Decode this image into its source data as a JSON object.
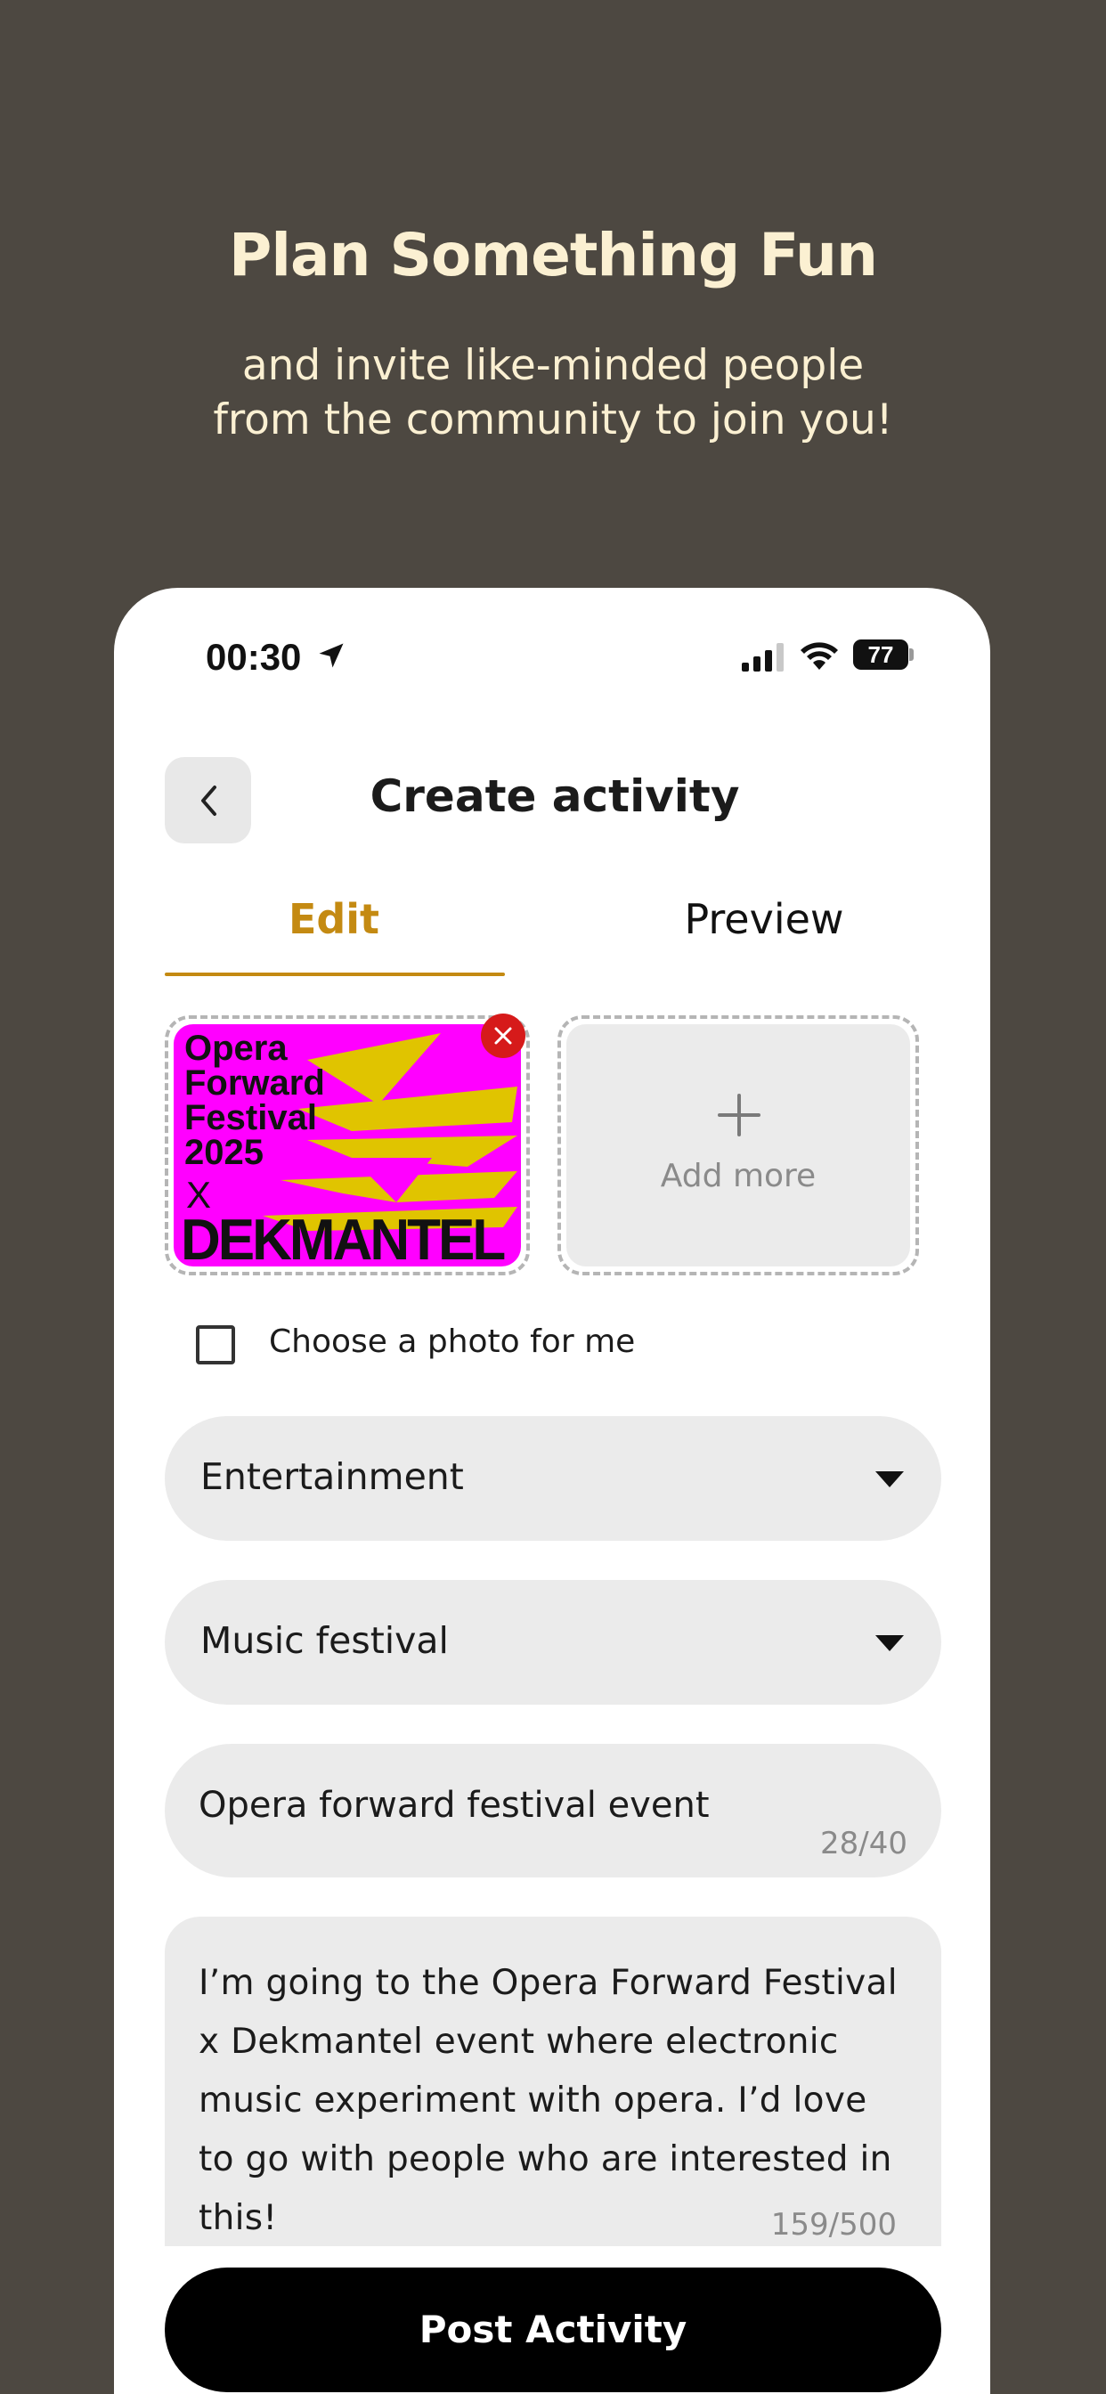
{
  "promo": {
    "headline": "Plan Something Fun",
    "subline": "and invite like-minded people\nfrom the community to join you!"
  },
  "status_bar": {
    "time": "00:30",
    "battery": "77",
    "icons": [
      "location-arrow-icon",
      "cellular-signal-icon",
      "wifi-icon",
      "battery-icon"
    ]
  },
  "header": {
    "title": "Create activity",
    "back_icon": "chevron-left-icon"
  },
  "tabs": [
    {
      "label": "Edit",
      "active": true
    },
    {
      "label": "Preview",
      "active": false
    }
  ],
  "photos": {
    "poster_title": "Opera\nForward\nFestival\n2025",
    "poster_x": "X",
    "poster_brand": "DEKMANTEL",
    "remove_icon": "close-icon",
    "add_label": "Add more"
  },
  "choose_photo": {
    "label": "Choose a photo for me",
    "checked": false
  },
  "category_select": {
    "value": "Entertainment"
  },
  "subcategory_select": {
    "value": "Music festival"
  },
  "title_field": {
    "value": "Opera forward festival event",
    "count": "28/40"
  },
  "description_field": {
    "value": "I’m going to the Opera Forward Festival x Dekmantel event where electronic music experiment with opera. I’d love to go with people who are interested in this!",
    "count": "159/500"
  },
  "post_button": {
    "label": "Post Activity"
  },
  "colors": {
    "background": "#4d4841",
    "headline": "#fbf0d2",
    "accent": "#c48a12",
    "poster_magenta": "#ff00ff",
    "poster_yellow": "#e0c400",
    "remove_red": "#d61a1a"
  }
}
